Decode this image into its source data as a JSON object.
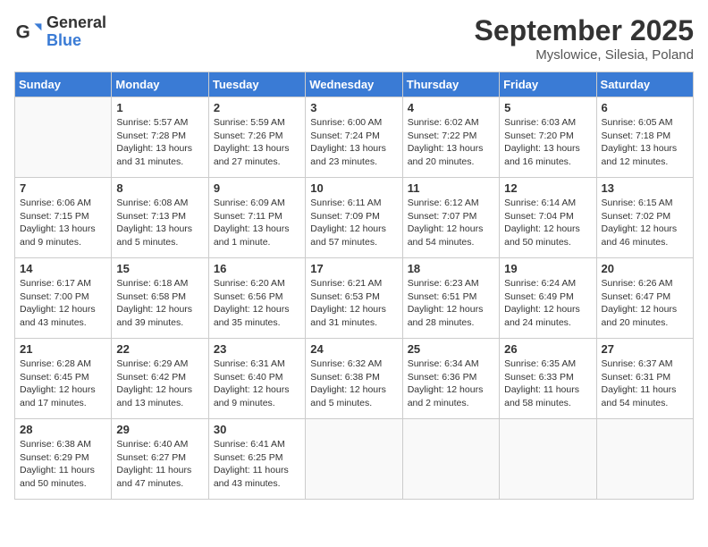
{
  "header": {
    "logo_general": "General",
    "logo_blue": "Blue",
    "month_title": "September 2025",
    "location": "Myslowice, Silesia, Poland"
  },
  "weekdays": [
    "Sunday",
    "Monday",
    "Tuesday",
    "Wednesday",
    "Thursday",
    "Friday",
    "Saturday"
  ],
  "weeks": [
    [
      {
        "day": "",
        "info": ""
      },
      {
        "day": "1",
        "info": "Sunrise: 5:57 AM\nSunset: 7:28 PM\nDaylight: 13 hours\nand 31 minutes."
      },
      {
        "day": "2",
        "info": "Sunrise: 5:59 AM\nSunset: 7:26 PM\nDaylight: 13 hours\nand 27 minutes."
      },
      {
        "day": "3",
        "info": "Sunrise: 6:00 AM\nSunset: 7:24 PM\nDaylight: 13 hours\nand 23 minutes."
      },
      {
        "day": "4",
        "info": "Sunrise: 6:02 AM\nSunset: 7:22 PM\nDaylight: 13 hours\nand 20 minutes."
      },
      {
        "day": "5",
        "info": "Sunrise: 6:03 AM\nSunset: 7:20 PM\nDaylight: 13 hours\nand 16 minutes."
      },
      {
        "day": "6",
        "info": "Sunrise: 6:05 AM\nSunset: 7:18 PM\nDaylight: 13 hours\nand 12 minutes."
      }
    ],
    [
      {
        "day": "7",
        "info": "Sunrise: 6:06 AM\nSunset: 7:15 PM\nDaylight: 13 hours\nand 9 minutes."
      },
      {
        "day": "8",
        "info": "Sunrise: 6:08 AM\nSunset: 7:13 PM\nDaylight: 13 hours\nand 5 minutes."
      },
      {
        "day": "9",
        "info": "Sunrise: 6:09 AM\nSunset: 7:11 PM\nDaylight: 13 hours\nand 1 minute."
      },
      {
        "day": "10",
        "info": "Sunrise: 6:11 AM\nSunset: 7:09 PM\nDaylight: 12 hours\nand 57 minutes."
      },
      {
        "day": "11",
        "info": "Sunrise: 6:12 AM\nSunset: 7:07 PM\nDaylight: 12 hours\nand 54 minutes."
      },
      {
        "day": "12",
        "info": "Sunrise: 6:14 AM\nSunset: 7:04 PM\nDaylight: 12 hours\nand 50 minutes."
      },
      {
        "day": "13",
        "info": "Sunrise: 6:15 AM\nSunset: 7:02 PM\nDaylight: 12 hours\nand 46 minutes."
      }
    ],
    [
      {
        "day": "14",
        "info": "Sunrise: 6:17 AM\nSunset: 7:00 PM\nDaylight: 12 hours\nand 43 minutes."
      },
      {
        "day": "15",
        "info": "Sunrise: 6:18 AM\nSunset: 6:58 PM\nDaylight: 12 hours\nand 39 minutes."
      },
      {
        "day": "16",
        "info": "Sunrise: 6:20 AM\nSunset: 6:56 PM\nDaylight: 12 hours\nand 35 minutes."
      },
      {
        "day": "17",
        "info": "Sunrise: 6:21 AM\nSunset: 6:53 PM\nDaylight: 12 hours\nand 31 minutes."
      },
      {
        "day": "18",
        "info": "Sunrise: 6:23 AM\nSunset: 6:51 PM\nDaylight: 12 hours\nand 28 minutes."
      },
      {
        "day": "19",
        "info": "Sunrise: 6:24 AM\nSunset: 6:49 PM\nDaylight: 12 hours\nand 24 minutes."
      },
      {
        "day": "20",
        "info": "Sunrise: 6:26 AM\nSunset: 6:47 PM\nDaylight: 12 hours\nand 20 minutes."
      }
    ],
    [
      {
        "day": "21",
        "info": "Sunrise: 6:28 AM\nSunset: 6:45 PM\nDaylight: 12 hours\nand 17 minutes."
      },
      {
        "day": "22",
        "info": "Sunrise: 6:29 AM\nSunset: 6:42 PM\nDaylight: 12 hours\nand 13 minutes."
      },
      {
        "day": "23",
        "info": "Sunrise: 6:31 AM\nSunset: 6:40 PM\nDaylight: 12 hours\nand 9 minutes."
      },
      {
        "day": "24",
        "info": "Sunrise: 6:32 AM\nSunset: 6:38 PM\nDaylight: 12 hours\nand 5 minutes."
      },
      {
        "day": "25",
        "info": "Sunrise: 6:34 AM\nSunset: 6:36 PM\nDaylight: 12 hours\nand 2 minutes."
      },
      {
        "day": "26",
        "info": "Sunrise: 6:35 AM\nSunset: 6:33 PM\nDaylight: 11 hours\nand 58 minutes."
      },
      {
        "day": "27",
        "info": "Sunrise: 6:37 AM\nSunset: 6:31 PM\nDaylight: 11 hours\nand 54 minutes."
      }
    ],
    [
      {
        "day": "28",
        "info": "Sunrise: 6:38 AM\nSunset: 6:29 PM\nDaylight: 11 hours\nand 50 minutes."
      },
      {
        "day": "29",
        "info": "Sunrise: 6:40 AM\nSunset: 6:27 PM\nDaylight: 11 hours\nand 47 minutes."
      },
      {
        "day": "30",
        "info": "Sunrise: 6:41 AM\nSunset: 6:25 PM\nDaylight: 11 hours\nand 43 minutes."
      },
      {
        "day": "",
        "info": ""
      },
      {
        "day": "",
        "info": ""
      },
      {
        "day": "",
        "info": ""
      },
      {
        "day": "",
        "info": ""
      }
    ]
  ]
}
